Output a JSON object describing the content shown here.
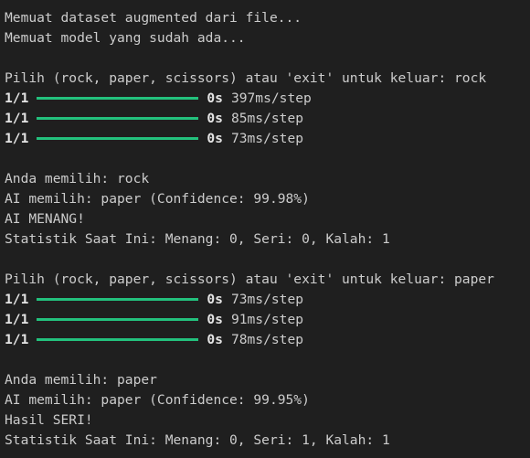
{
  "lines": [
    {
      "kind": "text",
      "text": "Memuat dataset augmented dari file..."
    },
    {
      "kind": "text",
      "text": "Memuat model yang sudah ada..."
    },
    {
      "kind": "blank"
    },
    {
      "kind": "text",
      "text": "Pilih (rock, paper, scissors) atau 'exit' untuk keluar: rock"
    },
    {
      "kind": "progress",
      "count": "1/1",
      "time": "0s",
      "rate": "397ms/step",
      "progress": 1.0
    },
    {
      "kind": "progress",
      "count": "1/1",
      "time": "0s",
      "rate": "85ms/step",
      "progress": 1.0
    },
    {
      "kind": "progress",
      "count": "1/1",
      "time": "0s",
      "rate": "73ms/step",
      "progress": 1.0
    },
    {
      "kind": "blank"
    },
    {
      "kind": "text",
      "text": "Anda memilih: rock"
    },
    {
      "kind": "text",
      "text": "AI memilih: paper (Confidence: 99.98%)"
    },
    {
      "kind": "text",
      "text": "AI MENANG!"
    },
    {
      "kind": "text",
      "text": "Statistik Saat Ini: Menang: 0, Seri: 0, Kalah: 1"
    },
    {
      "kind": "blank"
    },
    {
      "kind": "text",
      "text": "Pilih (rock, paper, scissors) atau 'exit' untuk keluar: paper"
    },
    {
      "kind": "progress",
      "count": "1/1",
      "time": "0s",
      "rate": "73ms/step",
      "progress": 1.0
    },
    {
      "kind": "progress",
      "count": "1/1",
      "time": "0s",
      "rate": "91ms/step",
      "progress": 1.0
    },
    {
      "kind": "progress",
      "count": "1/1",
      "time": "0s",
      "rate": "78ms/step",
      "progress": 1.0
    },
    {
      "kind": "blank"
    },
    {
      "kind": "text",
      "text": "Anda memilih: paper"
    },
    {
      "kind": "text",
      "text": "AI memilih: paper (Confidence: 99.95%)"
    },
    {
      "kind": "text",
      "text": "Hasil SERI!"
    },
    {
      "kind": "text",
      "text": "Statistik Saat Ini: Menang: 0, Seri: 1, Kalah: 1"
    }
  ],
  "colors": {
    "background": "#1f1f1f",
    "text": "#cccccc",
    "progress_bar": "#23c17d"
  }
}
